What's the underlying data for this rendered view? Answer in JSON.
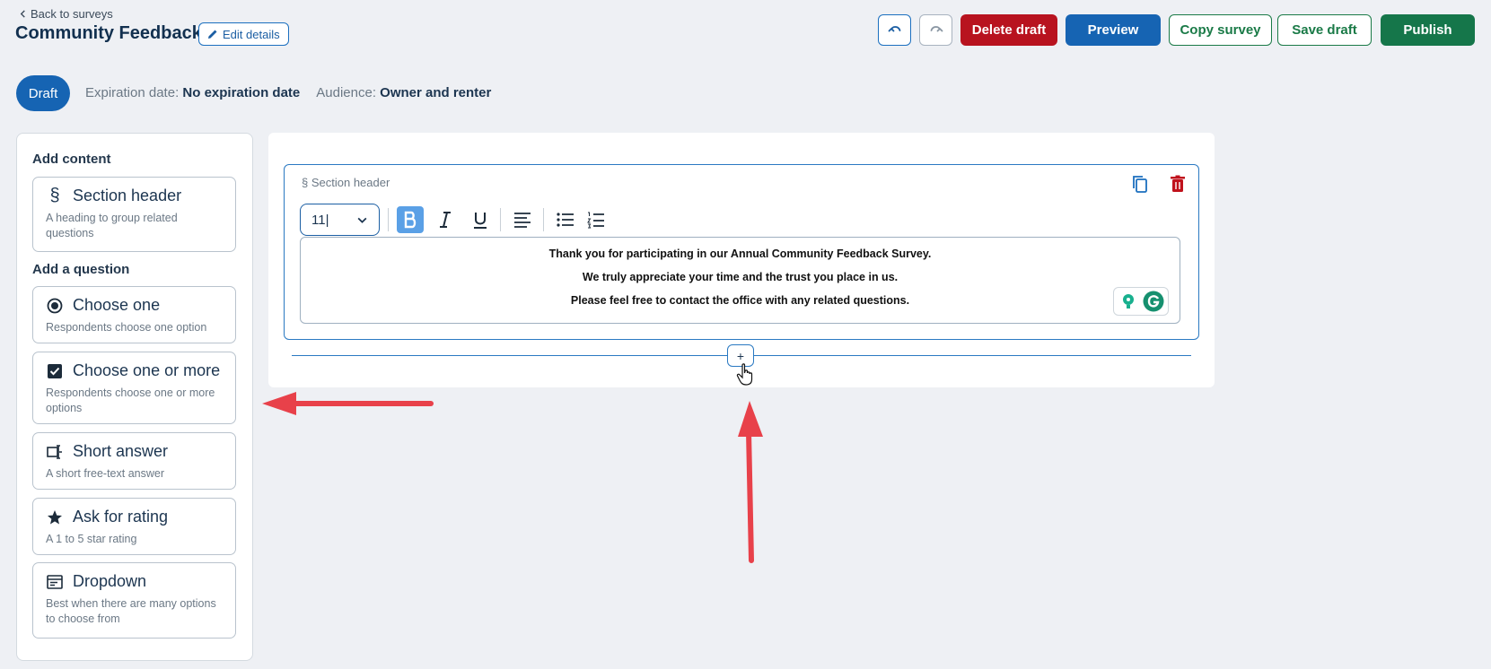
{
  "header": {
    "back_label": "Back to surveys",
    "title": "Community Feedback",
    "edit_details_label": "Edit details"
  },
  "toolbar": {
    "undo_icon": "undo-icon",
    "redo_icon": "redo-icon",
    "delete_label": "Delete draft",
    "preview_label": "Preview",
    "copy_label": "Copy survey",
    "save_label": "Save draft",
    "publish_label": "Publish"
  },
  "status": {
    "badge": "Draft",
    "expiration_key": "Expiration date:",
    "expiration_value": "No expiration date",
    "audience_key": "Audience:",
    "audience_value": "Owner and renter"
  },
  "sidebar": {
    "add_content_heading": "Add content",
    "add_question_heading": "Add a question",
    "content_items": [
      {
        "title": "Section header",
        "desc": "A heading to group related questions",
        "icon": "section-icon"
      }
    ],
    "question_items": [
      {
        "title": "Choose one",
        "desc": "Respondents choose one option",
        "icon": "radio-icon"
      },
      {
        "title": "Choose one or more",
        "desc": "Respondents choose one or more options",
        "icon": "checkbox-icon"
      },
      {
        "title": "Short answer",
        "desc": "A short free-text answer",
        "icon": "text-field-icon"
      },
      {
        "title": "Ask for rating",
        "desc": "A 1 to 5 star rating",
        "icon": "star-icon"
      },
      {
        "title": "Dropdown",
        "desc": "Best when there are many options to choose from",
        "icon": "dropdown-icon"
      }
    ]
  },
  "section": {
    "label": "§  Section header",
    "font_size": "11|",
    "lines": [
      "Thank you for participating in our Annual Community Feedback Survey.",
      "We truly appreciate your time and the trust you place in us.",
      "Please feel free to contact the office with any related questions."
    ],
    "add_button": "+"
  },
  "colors": {
    "primary": "#1664b3",
    "danger": "#b8131f",
    "success": "#15764a",
    "annotation": "#e8414a"
  }
}
